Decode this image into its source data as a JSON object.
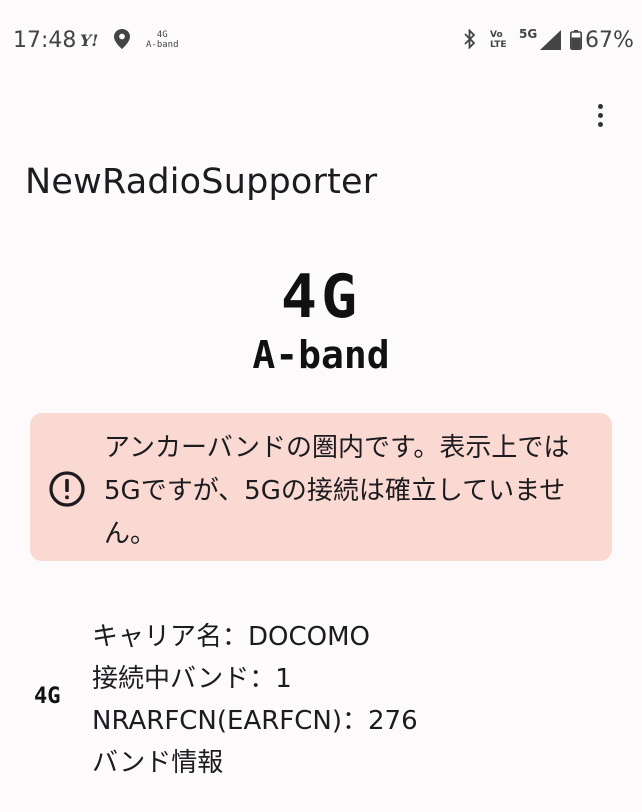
{
  "status_bar": {
    "time": "17:48",
    "yahoo_icon": "Y!",
    "location_icon": "location-pin-icon",
    "network_4g_top": "4G",
    "network_4g_bottom": "A-band",
    "bluetooth_icon": "bluetooth-icon",
    "volte_top": "Vo",
    "volte_bottom": "LTE",
    "network_5g": "5G",
    "signal_icon": "cell-signal-icon",
    "battery_icon": "battery-icon",
    "battery_percent": "67%"
  },
  "app_bar": {
    "title": "NewRadioSupporter",
    "menu_icon": "more-vert-icon"
  },
  "hero": {
    "generation": "4G",
    "band": "A-band"
  },
  "alert": {
    "icon": "error-outline-icon",
    "message": "アンカーバンドの圏内です。表示上では5Gですが、5Gの接続は確立していません。",
    "background": "#fbd9d3"
  },
  "info": {
    "gen_icon": "4G",
    "carrier": "キャリア名：DOCOMO",
    "band": "接続中バンド：1",
    "arfcn": "NRARFCN(EARFCN)：276",
    "band_info": "バンド情報"
  }
}
